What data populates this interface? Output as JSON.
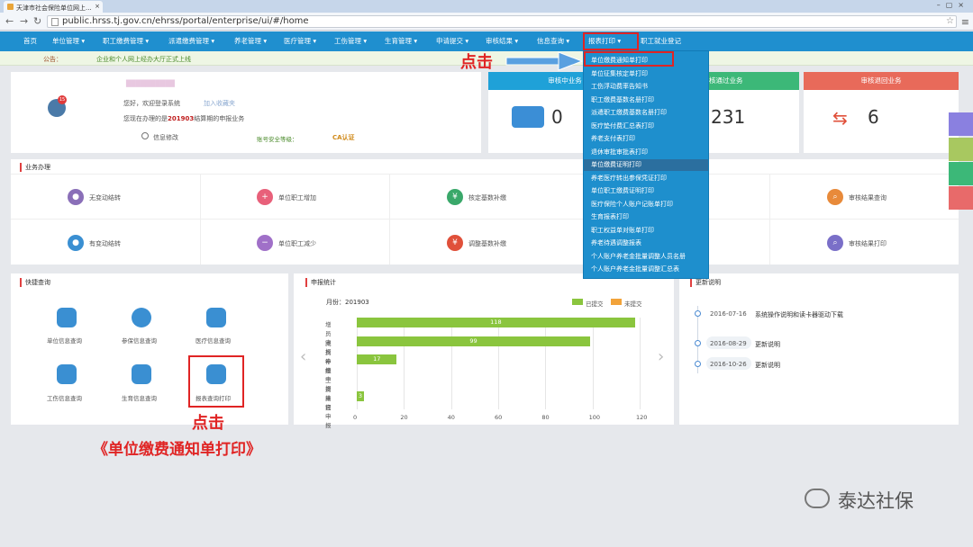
{
  "browser": {
    "tab_title": "天津市社会保险单位网上...",
    "url": "public.hrss.tj.gov.cn/ehrss/portal/enterprise/ui/#/home"
  },
  "nav": {
    "items": [
      "首页",
      "单位管理",
      "职工缴费管理",
      "派遣缴费管理",
      "养老管理",
      "医疗管理",
      "工伤管理",
      "生育管理",
      "申请提交",
      "审核结果",
      "信息查询",
      "报表打印",
      "职工就业登记"
    ]
  },
  "notice": {
    "label": "公告：",
    "text": "企业和个人网上经办大厅正式上线"
  },
  "profile": {
    "name_masked": "██████████",
    "greeting": "您好，欢迎登录系统",
    "add_fav": "加入收藏夹",
    "status_text_pre": "您现在办理的是",
    "period": "201903",
    "status_text_post": "结算期的申报业务",
    "info_edit": "信息修改",
    "security_label": "账号安全等级：",
    "ca_label": "CA认证",
    "badge_count": "15"
  },
  "stats": [
    {
      "title": "审核中业务",
      "value": "0"
    },
    {
      "title": "审核通过业务",
      "value": "231"
    },
    {
      "title": "审核退回业务",
      "value": "6"
    }
  ],
  "business": {
    "title": "业务办理",
    "items": [
      "无变动结转",
      "单位职工增加",
      "核定基数补缴",
      "审核结果查询",
      "有变动结转",
      "单位职工减少",
      "调整基数补缴",
      "审核结果打印"
    ]
  },
  "dropdown": {
    "items": [
      "单位缴费通知单打印",
      "单位征集核定单打印",
      "工伤浮动费率告知书",
      "职工缴费基数名册打印",
      "派遣职工缴费基数名册打印",
      "医疗垫付费汇总表打印",
      "养老支付表打印",
      "退休审批审批表打印",
      "单位缴费证明打印",
      "养老医疗转出参保凭证打印",
      "单位职工缴费证明打印",
      "医疗保险个人账户记账单打印",
      "生育报表打印",
      "职工权益单对账单打印",
      "养老待遇调整报表",
      "个人账户养老金批量调整人员名册",
      "个人账户养老金批量调整汇总表"
    ]
  },
  "annotations": {
    "click1": "点击",
    "click2": "点击",
    "click_caption": "《单位缴费通知单打印》"
  },
  "quick": {
    "title": "快捷查询",
    "items": [
      "单位信息查询",
      "参保信息查询",
      "医疗信息查询",
      "工伤信息查询",
      "生育信息查询",
      "报表查询打印"
    ]
  },
  "chart_data": {
    "type": "bar",
    "title": "申报统计",
    "month_label": "月份：201903",
    "legend": [
      "已提交",
      "未提交"
    ],
    "categories": [
      "增员申报",
      "减员申报",
      "补缴申报",
      "工资申报",
      "其它申报"
    ],
    "values": [
      118,
      99,
      17,
      0,
      3
    ],
    "xlim": [
      0,
      120
    ],
    "xticks": [
      0,
      20,
      40,
      60,
      80,
      100,
      120
    ],
    "colors": {
      "submitted": "#8ac53e",
      "unsubmitted": "#f2a33a"
    }
  },
  "updates": {
    "title": "更新说明",
    "items": [
      {
        "date": "2016-07-16",
        "text": "系统操作说明和读卡器驱动下载"
      },
      {
        "date": "2016-08-29",
        "text": "更新说明"
      },
      {
        "date": "2016-10-26",
        "text": "更新说明"
      }
    ]
  },
  "watermark": "泰达社保",
  "colors": {
    "nav": "#1f8fcf",
    "stat1": "#1fa1d8",
    "stat2": "#3cb878",
    "stat3": "#e86a5a"
  }
}
